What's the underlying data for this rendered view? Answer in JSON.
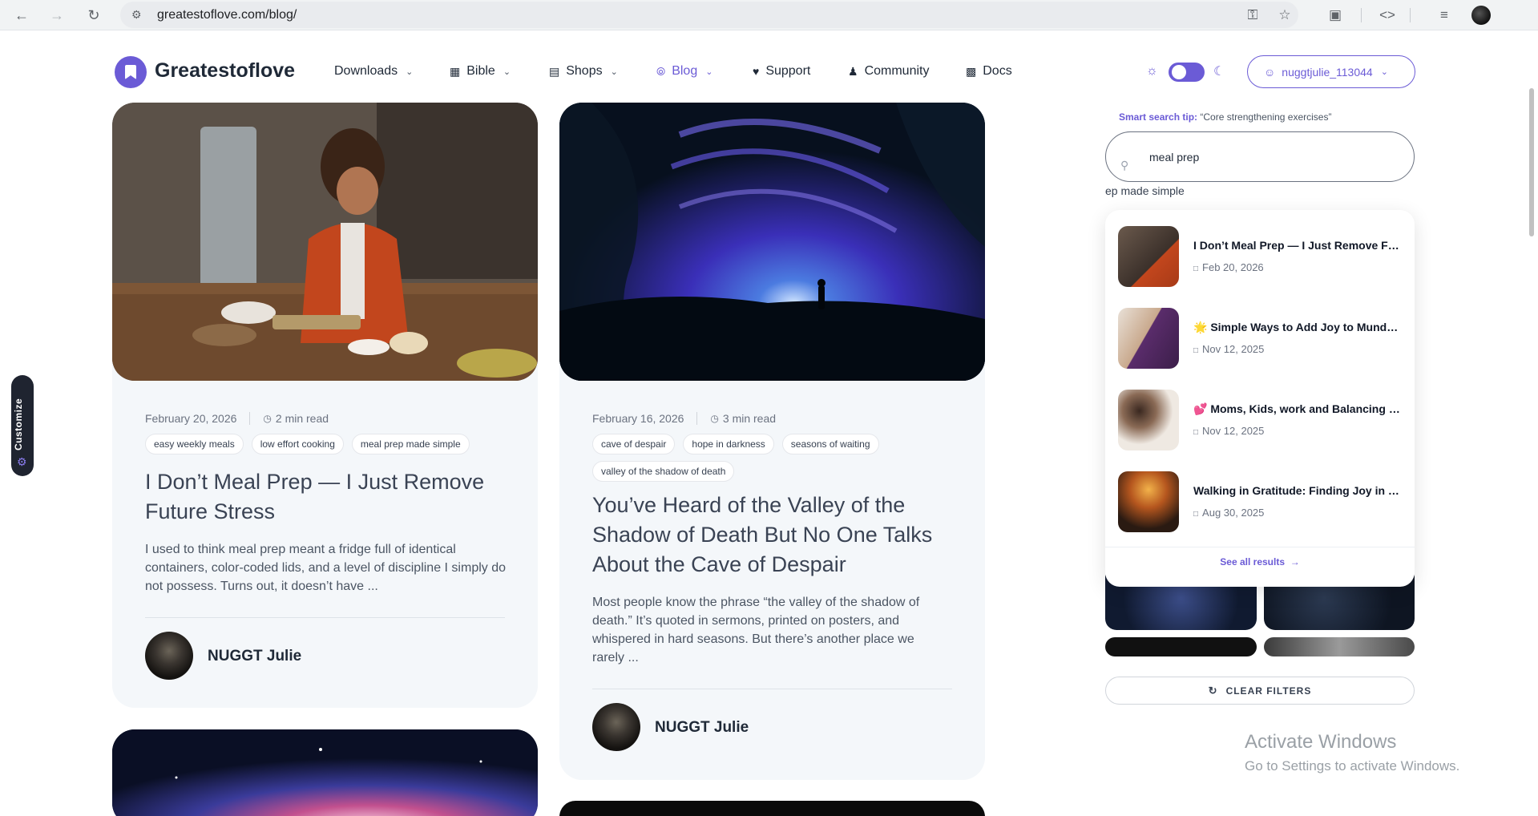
{
  "browser": {
    "url": "greatestoflove.com/blog/"
  },
  "header": {
    "brand": "Greatestoflove",
    "nav": [
      {
        "label": "Downloads"
      },
      {
        "label": "Bible"
      },
      {
        "label": "Shops"
      },
      {
        "label": "Blog"
      },
      {
        "label": "Support"
      },
      {
        "label": "Community"
      },
      {
        "label": "Docs"
      }
    ],
    "user": "nuggtjulie_113044"
  },
  "customize_label": "Customize",
  "posts": [
    {
      "date": "February 20, 2026",
      "read_time": "2 min read",
      "tags": [
        "easy weekly meals",
        "low effort cooking",
        "meal prep made simple"
      ],
      "title": "I Don’t Meal Prep — I Just Remove Future Stress",
      "excerpt": "I used to think meal prep meant a fridge full of identical containers, color-coded lids, and a level of discipline I simply do not possess. Turns out, it doesn’t have ...",
      "author": "NUGGT Julie"
    },
    {
      "date": "February 16, 2026",
      "read_time": "3 min read",
      "tags": [
        "cave of despair",
        "hope in darkness",
        "seasons of waiting",
        "valley of the shadow of death"
      ],
      "title": "You’ve Heard of the Valley of the Shadow of Death But No One Talks About the Cave of Despair",
      "excerpt": "Most people know the phrase “the valley of the shadow of death.” It’s quoted in sermons, printed on posters, and whispered in hard seasons. But there’s another place we rarely ...",
      "author": "NUGGT Julie"
    }
  ],
  "sidebar": {
    "tip_label": "Smart search tip:",
    "tip_text": "“Core strengthening exercises”",
    "search_value": "meal prep",
    "peek_text": "ep made simple",
    "results": [
      {
        "title": "I Don’t Meal Prep — I Just Remove Future Stress",
        "date": "Feb 20, 2026"
      },
      {
        "title": "🌟 Simple Ways to Add Joy to Mundane Days",
        "date": "Nov 12, 2025"
      },
      {
        "title": "💕 Moms, Kids, work and Balancing It All",
        "date": "Nov 12, 2025"
      },
      {
        "title": "Walking in Gratitude: Finding Joy in the Little Things",
        "date": "Aug 30, 2025"
      }
    ],
    "see_all": "See all results",
    "clear_filters": "CLEAR FILTERS"
  },
  "watermark": {
    "title": "Activate Windows",
    "subtitle": "Go to Settings to activate Windows."
  }
}
